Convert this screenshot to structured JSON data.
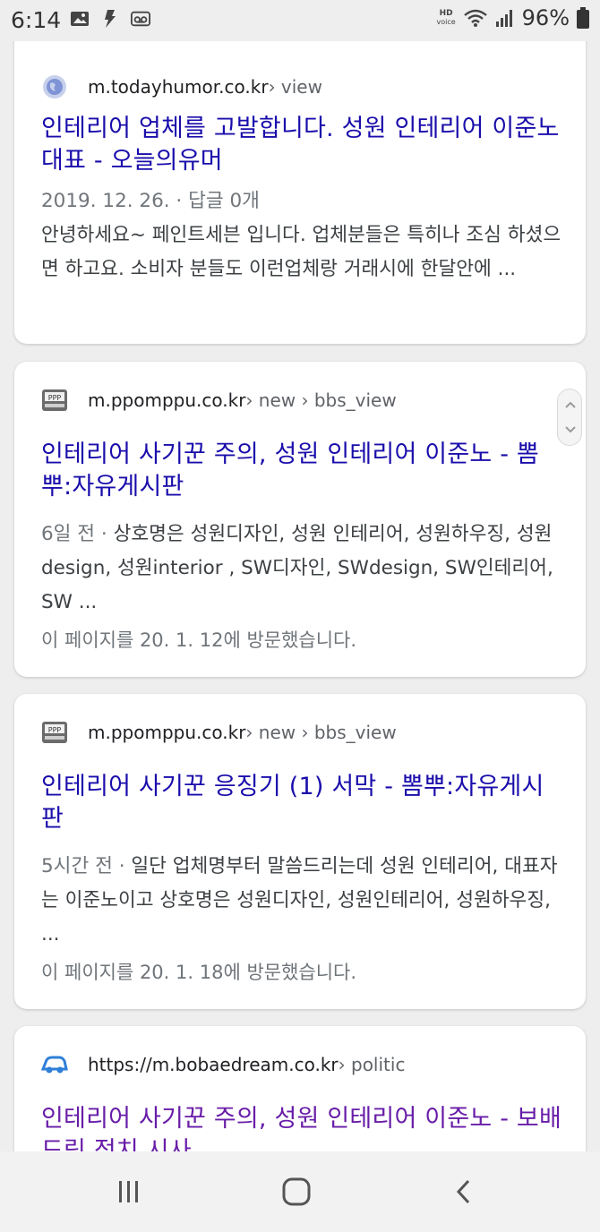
{
  "status_bar": {
    "time": "6:14",
    "battery": "96%",
    "hd_voice_top": "HD",
    "hd_voice_bottom": "voice"
  },
  "results": [
    {
      "domain": "m.todayhumor.co.kr",
      "path": " › view",
      "favicon": "globe-icon",
      "title": "인테리어 업체를 고발합니다. 성원 인테리어 이준노 대표 - 오늘의유머",
      "meta": "2019. 12. 26. · 답글 0개",
      "snippet": "안녕하세요~ 페인트세븐 입니다. 업체분들은 특히나 조심 하셨으면 하고요. 소비자 분들도 이런업체랑 거래시에 한달안에 ..."
    },
    {
      "domain": "m.ppomppu.co.kr",
      "path": " › new › bbs_view",
      "favicon": "ppomppu-icon",
      "title": "인테리어 사기꾼 주의, 성원 인테리어 이준노 - 뽐뿌:자유게시판",
      "meta": "6일 전 · ",
      "snippet": "상호명은 성원디자인, 성원 인테리어, 성원하우징, 성원design, 성원interior , SW디자인, SWdesign, SW인테리어, SW ...",
      "visited": "이 페이지를 20. 1. 12에 방문했습니다."
    },
    {
      "domain": "m.ppomppu.co.kr",
      "path": " › new › bbs_view",
      "favicon": "ppomppu-icon",
      "title": "인테리어 사기꾼 응징기 (1) 서막 - 뽐뿌:자유게시판",
      "meta": "5시간 전 · ",
      "snippet": "일단 업체명부터 말씀드리는데 성원 인테리어, 대표자는 이준노이고 상호명은 성원디자인, 성원인테리어, 성원하우징, ...",
      "visited": "이 페이지를 20. 1. 18에 방문했습니다."
    },
    {
      "domain": "https://m.bobaedream.co.kr",
      "path": " › politic",
      "favicon": "bobaedream-icon",
      "title": "인테리어 사기꾼 주의, 성원 인테리어 이준노 - 보배드림 정치 시사"
    }
  ],
  "colors": {
    "link": "#1a0dab",
    "visited_link": "#681da8",
    "meta": "#70757a",
    "background": "#eeeeee"
  }
}
